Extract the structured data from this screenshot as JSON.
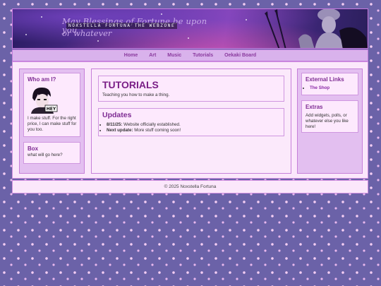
{
  "banner": {
    "motto_line1": "May Blessings of Fortune be upon you",
    "motto_line2": "or whatever",
    "tag": "NOXSTELLA FORTUNA THE WEBZONE"
  },
  "nav": {
    "items": [
      "Home",
      "Art",
      "Music",
      "Tutorials",
      "Oekaki Board"
    ]
  },
  "left": {
    "who": {
      "title": "Who am I?",
      "avatar_text": "HEY",
      "text": "I make stuff. For the right price, I can make stuff for you too."
    },
    "box": {
      "title": "Box",
      "text": "what will go here?"
    }
  },
  "main": {
    "title": "TUTORIALS",
    "subtitle": "Teaching you how to make a thing.",
    "updates": {
      "title": "Updates",
      "items": [
        {
          "date": "8/11/25:",
          "text": "Website officially established."
        },
        {
          "date": "Next update:",
          "text": "More stuff coming soon!"
        }
      ]
    }
  },
  "right": {
    "links": {
      "title": "External Links",
      "items": [
        "The Shop"
      ]
    },
    "extras": {
      "title": "Extras",
      "text": "Add widgets, polls, or whatever else you like here!"
    }
  },
  "footer": {
    "text": "© 2025 Noxstella Fortuna"
  },
  "colors": {
    "accent": "#7e2b93",
    "nav_bg": "#d9b2ec",
    "page_bg": "#6b62a8",
    "panel_bg": "#fbe7fb"
  },
  "icons": [
    "avatar-image",
    "statue-image",
    "sword-icon"
  ]
}
